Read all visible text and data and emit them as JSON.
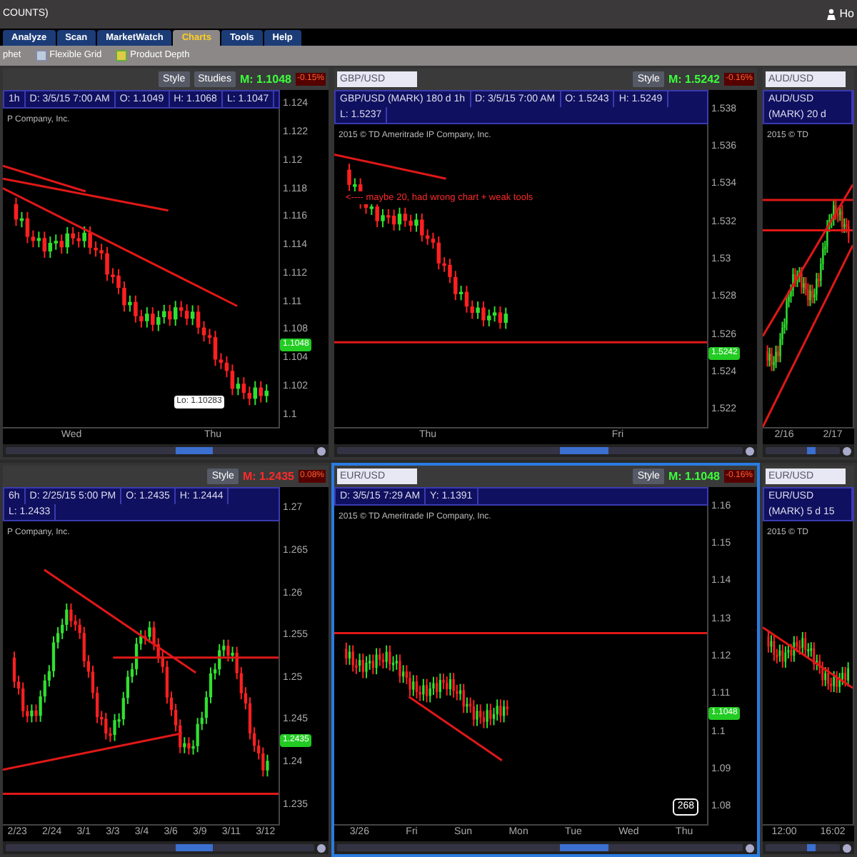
{
  "window": {
    "title": "COUNTS)",
    "user": "Ho"
  },
  "tabs": [
    {
      "label": "Analyze",
      "selected": false
    },
    {
      "label": "Scan",
      "selected": false
    },
    {
      "label": "MarketWatch",
      "selected": false
    },
    {
      "label": "Charts",
      "selected": true
    },
    {
      "label": "Tools",
      "selected": false
    },
    {
      "label": "Help",
      "selected": false
    }
  ],
  "toolbar": [
    {
      "kind": "text",
      "label": "phet"
    },
    {
      "kind": "grid",
      "label": "Flexible Grid"
    },
    {
      "kind": "depth",
      "label": "Product Depth"
    }
  ],
  "panels": [
    {
      "selected": false,
      "buttons": [
        "Style",
        "Studies"
      ],
      "mark": {
        "text": "M: 1.1048",
        "color": "#3cff3c"
      },
      "change": "-0.15%",
      "info": [
        "1h",
        "D: 3/5/15 7:00 AM",
        "O: 1.1049",
        "H: 1.1068",
        "L: 1.1047"
      ],
      "copyright": "P Company, Inc.",
      "y_labels": [
        "1.124",
        "1.122",
        "1.12",
        "1.118",
        "1.116",
        "1.114",
        "1.112",
        "1.11",
        "1.108",
        "1.104",
        "1.102",
        "1.1"
      ],
      "price_tag": "1.1048",
      "low_label": "Lo: 1.10283",
      "x_labels": [
        "Wed",
        "Thu"
      ]
    },
    {
      "selected": false,
      "symbol": "GBP/USD",
      "buttons": [
        "Style"
      ],
      "mark": {
        "text": "M: 1.5242",
        "color": "#3cff3c"
      },
      "change": "-0.16%",
      "info": [
        "GBP/USD (MARK) 180 d 1h",
        "D: 3/5/15 7:00 AM",
        "O: 1.5243",
        "H: 1.5249",
        "L: 1.5237"
      ],
      "copyright": "2015 © TD Ameritrade IP Company, Inc.",
      "annotation": "<---- maybe 20, had wrong chart + weak tools",
      "y_labels": [
        "1.538",
        "1.536",
        "1.534",
        "1.532",
        "1.53",
        "1.528",
        "1.526",
        "1.524",
        "1.522"
      ],
      "price_tag": "1.5242",
      "x_labels": [
        "Thu",
        "Fri"
      ]
    },
    {
      "selected": false,
      "symbol": "AUD/USD",
      "info": [
        "AUD/USD (MARK) 20 d"
      ],
      "copyright": "2015 © TD",
      "x_labels": [
        "2/16",
        "2/17"
      ]
    },
    {
      "selected": false,
      "buttons": [
        "Style"
      ],
      "mark": {
        "text": "M: 1.2435",
        "color": "#ff2a2a"
      },
      "change": "0.08%",
      "info": [
        "6h",
        "D: 2/25/15 5:00 PM",
        "O: 1.2435",
        "H: 1.2444",
        "L: 1.2433"
      ],
      "copyright": "P Company, Inc.",
      "y_labels": [
        "1.27",
        "1.265",
        "1.26",
        "1.255",
        "1.25",
        "1.245",
        "1.24",
        "1.235"
      ],
      "price_tag": "1.2435",
      "x_labels": [
        "2/23",
        "2/24",
        "3/1",
        "3/3",
        "3/4",
        "3/6",
        "3/9",
        "3/11",
        "3/12"
      ]
    },
    {
      "selected": true,
      "symbol": "EUR/USD",
      "buttons": [
        "Style"
      ],
      "mark": {
        "text": "M: 1.1048",
        "color": "#3cff3c"
      },
      "change": "-0.16%",
      "info": [
        "D: 3/5/15 7:29 AM",
        "Y: 1.1391"
      ],
      "copyright": "2015 © TD Ameritrade IP Company, Inc.",
      "y_labels": [
        "1.16",
        "1.15",
        "1.14",
        "1.13",
        "1.12",
        "1.11",
        "1.1",
        "1.09",
        "1.08"
      ],
      "price_tag": "1.1048",
      "badge": "268",
      "x_labels": [
        "3/26",
        "Fri",
        "Sun",
        "Mon",
        "Tue",
        "Wed",
        "Thu"
      ]
    },
    {
      "selected": false,
      "symbol": "EUR/USD",
      "info": [
        "EUR/USD (MARK) 5 d 15"
      ],
      "copyright": "2015 © TD",
      "x_labels": [
        "12:00",
        "16:02"
      ]
    }
  ]
}
